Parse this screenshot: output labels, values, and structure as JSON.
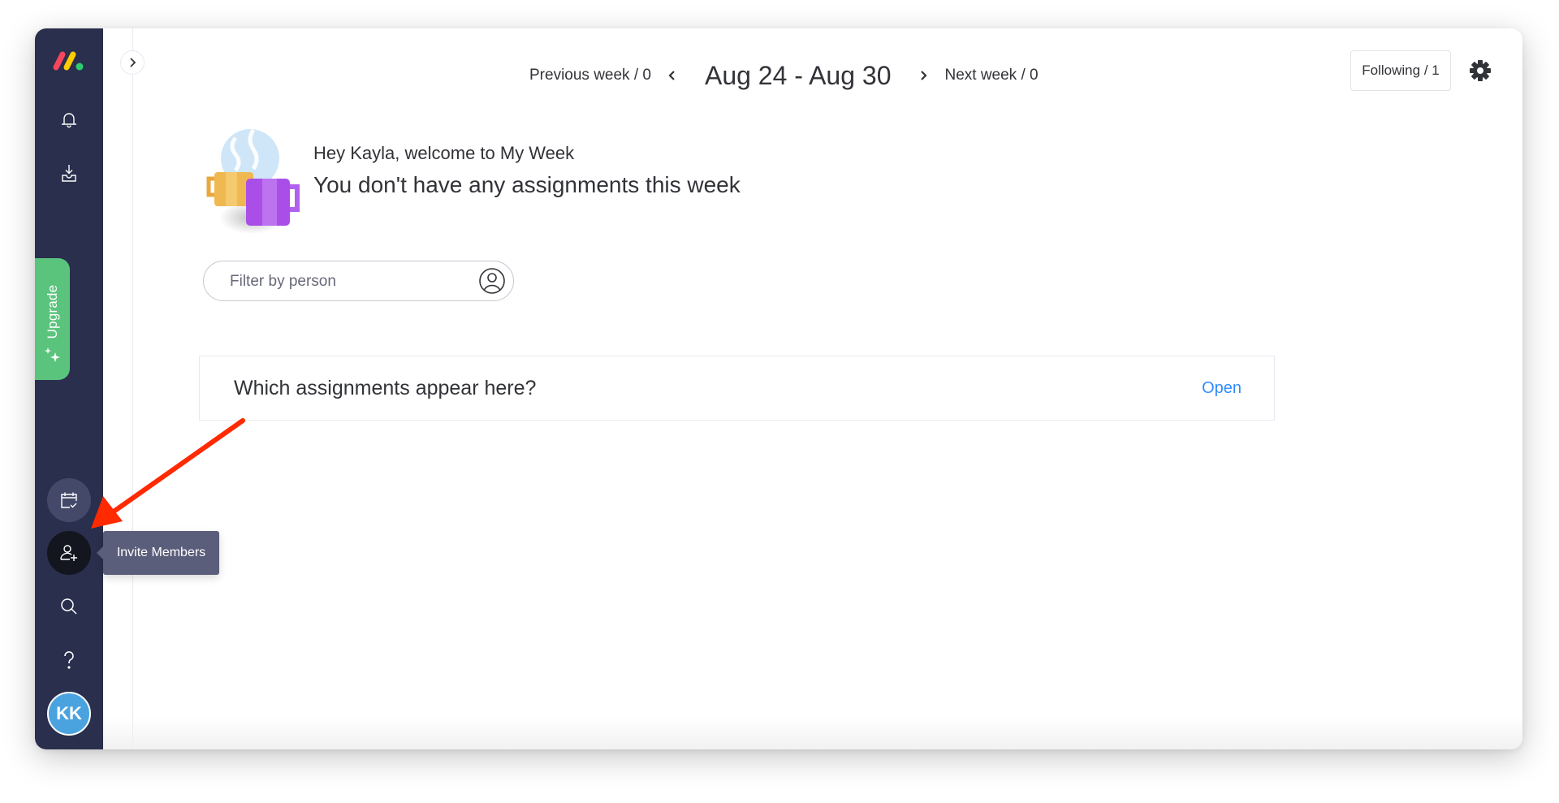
{
  "sidebar": {
    "logo": "monday-logo",
    "icons": [
      {
        "name": "notifications",
        "icon": "bell-icon"
      },
      {
        "name": "inbox",
        "icon": "inbox-download-icon"
      },
      {
        "name": "my-week",
        "icon": "calendar-check-icon"
      },
      {
        "name": "invite-members",
        "icon": "user-plus-icon"
      },
      {
        "name": "search",
        "icon": "search-icon"
      },
      {
        "name": "help",
        "icon": "question-icon"
      }
    ],
    "upgrade_label": "Upgrade",
    "avatar_initials": "KK",
    "avatar_color": "#4aa3df",
    "tooltip": "Invite Members"
  },
  "header": {
    "previous_week": "Previous week / 0",
    "date_range": "Aug 24 - Aug 30",
    "next_week": "Next week / 0",
    "following": "Following / 1"
  },
  "welcome": {
    "greeting": "Hey Kayla, welcome to My Week",
    "message": "You don't have any assignments this week"
  },
  "filter": {
    "placeholder": "Filter by person",
    "value": ""
  },
  "info_card": {
    "title": "Which assignments appear here?",
    "action": "Open"
  },
  "colors": {
    "sidebar_bg": "#292f4c",
    "upgrade_green": "#5ac47d",
    "link_blue": "#2f8bfd",
    "annotation_red": "#ff2a00"
  }
}
